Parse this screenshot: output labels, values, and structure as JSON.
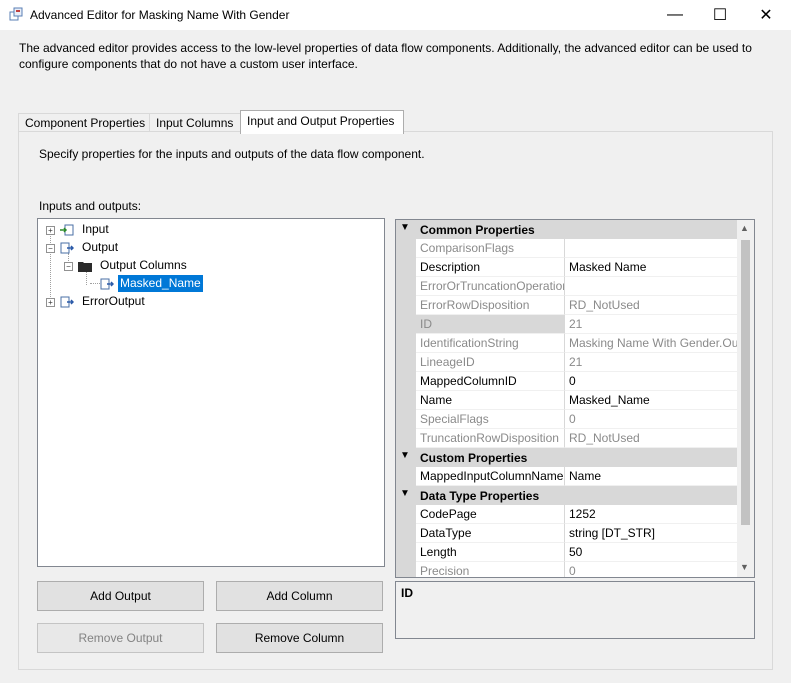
{
  "window": {
    "title": "Advanced Editor for Masking Name With Gender",
    "minimize_glyph": "—",
    "maximize_glyph": "☐",
    "close_glyph": "✕"
  },
  "description": "The advanced editor provides access to the low-level properties of data flow components. Additionally, the advanced editor can be used to configure components that do not have a custom user interface.",
  "tabs": [
    {
      "label": "Component Properties",
      "active": false
    },
    {
      "label": "Input Columns",
      "active": false
    },
    {
      "label": "Input and Output Properties",
      "active": true
    }
  ],
  "panel": {
    "instruction": "Specify properties for the inputs and outputs of the data flow component.",
    "io_label": "Inputs and outputs:",
    "tree": {
      "input": "Input",
      "output": "Output",
      "output_columns": "Output Columns",
      "masked_name": "Masked_Name",
      "error_output": "ErrorOutput"
    },
    "buttons": {
      "add_output": "Add Output",
      "add_column": "Add Column",
      "remove_output": "Remove Output",
      "remove_column": "Remove Column"
    }
  },
  "properties": {
    "common_title": "Common Properties",
    "common": [
      {
        "name": "ComparisonFlags",
        "value": "",
        "readonly": true
      },
      {
        "name": "Description",
        "value": "Masked Name",
        "readonly": false
      },
      {
        "name": "ErrorOrTruncationOperation",
        "value": "",
        "readonly": true
      },
      {
        "name": "ErrorRowDisposition",
        "value": "RD_NotUsed",
        "readonly": true
      },
      {
        "name": "ID",
        "value": "21",
        "readonly": true
      },
      {
        "name": "IdentificationString",
        "value": "Masking Name With Gender.Ou",
        "readonly": true
      },
      {
        "name": "LineageID",
        "value": "21",
        "readonly": true
      },
      {
        "name": "MappedColumnID",
        "value": "0",
        "readonly": false
      },
      {
        "name": "Name",
        "value": "Masked_Name",
        "readonly": false
      },
      {
        "name": "SpecialFlags",
        "value": "0",
        "readonly": true
      },
      {
        "name": "TruncationRowDisposition",
        "value": "RD_NotUsed",
        "readonly": true
      }
    ],
    "custom_title": "Custom Properties",
    "custom": [
      {
        "name": "MappedInputColumnName",
        "value": "Name",
        "readonly": false
      }
    ],
    "datatype_title": "Data Type Properties",
    "datatype": [
      {
        "name": "CodePage",
        "value": "1252",
        "readonly": false
      },
      {
        "name": "DataType",
        "value": "string [DT_STR]",
        "readonly": false
      },
      {
        "name": "Length",
        "value": "50",
        "readonly": false
      },
      {
        "name": "Precision",
        "value": "0",
        "readonly": true
      }
    ],
    "selected_description_title": "ID"
  }
}
